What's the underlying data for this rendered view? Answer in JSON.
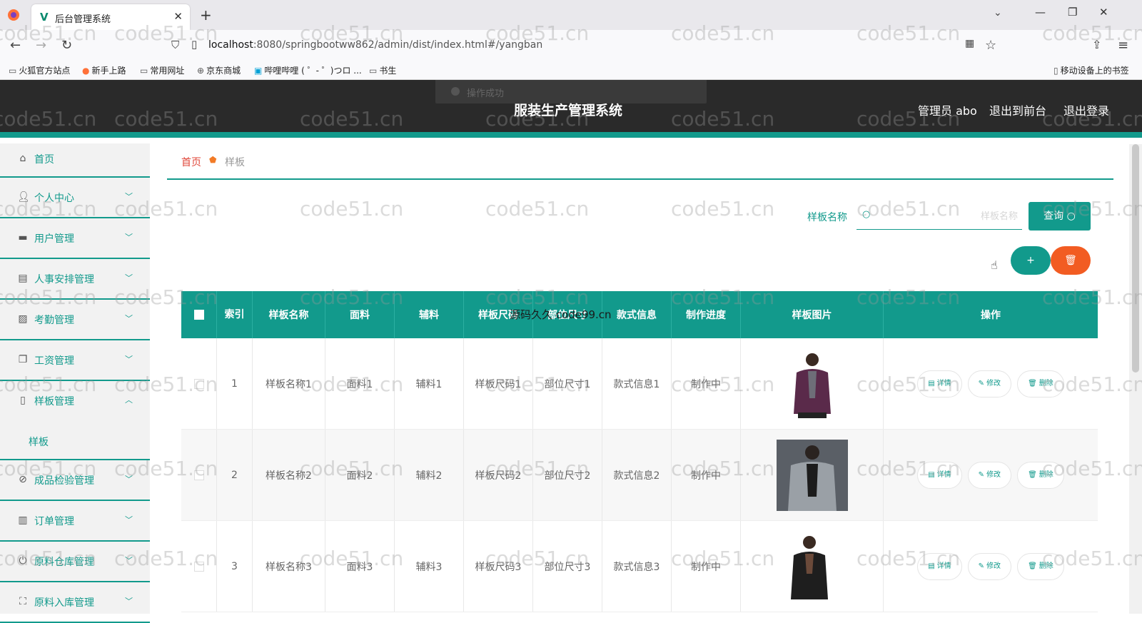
{
  "browser": {
    "tab_title": "后台管理系统",
    "url_host": "localhost",
    "url_rest": ":8080/springbootww862/admin/dist/index.html#/yangban",
    "bookmarks": [
      "火狐官方站点",
      "新手上路",
      "常用网址",
      "京东商城",
      "哔哩哔哩 ( ゜- ゜)つロ ...",
      "书生"
    ],
    "mobile_bookmarks": "移动设备上的书签"
  },
  "header": {
    "title": "服装生产管理系统",
    "user": "管理员 abo",
    "to_front": "退出到前台",
    "logout": "退出登录",
    "toast": "操作成功"
  },
  "sidebar": {
    "items": [
      {
        "label": "首页"
      },
      {
        "label": "个人中心"
      },
      {
        "label": "用户管理"
      },
      {
        "label": "人事安排管理"
      },
      {
        "label": "考勤管理"
      },
      {
        "label": "工资管理"
      },
      {
        "label": "样板管理"
      },
      {
        "label": "成品检验管理"
      },
      {
        "label": "订单管理"
      },
      {
        "label": "原料仓库管理"
      },
      {
        "label": "原料入库管理"
      }
    ],
    "sub_item": "样板"
  },
  "breadcrumb": {
    "home": "首页",
    "current": "样板"
  },
  "search": {
    "label": "样板名称",
    "placeholder": "样板名称",
    "button": "查询"
  },
  "actions": {
    "add": "+",
    "delete": "🗑"
  },
  "table": {
    "headers": [
      "索引",
      "样板名称",
      "面料",
      "辅料",
      "样板尺码",
      "部位尺寸",
      "款式信息",
      "制作进度",
      "样板图片",
      "操作"
    ],
    "overlay_text": "源码久久 code99.cn",
    "rows": [
      {
        "index": "1",
        "name": "样板名称1",
        "fabric": "面料1",
        "accessory": "辅料1",
        "size": "样板尺码1",
        "part_size": "部位尺寸1",
        "style": "款式信息1",
        "progress": "制作中"
      },
      {
        "index": "2",
        "name": "样板名称2",
        "fabric": "面料2",
        "accessory": "辅料2",
        "size": "样板尺码2",
        "part_size": "部位尺寸2",
        "style": "款式信息2",
        "progress": "制作中"
      },
      {
        "index": "3",
        "name": "样板名称3",
        "fabric": "面料3",
        "accessory": "辅料3",
        "size": "样板尺码3",
        "part_size": "部位尺寸3",
        "style": "款式信息3",
        "progress": "制作中"
      }
    ],
    "ops": {
      "detail": "详情",
      "edit": "修改",
      "delete": "删除"
    }
  },
  "watermark": "code51.cn",
  "colors": {
    "accent": "#129a8c",
    "danger": "#f25c22",
    "header_bg": "#2a2a2a",
    "breadcrumb_home": "#e0473a"
  }
}
